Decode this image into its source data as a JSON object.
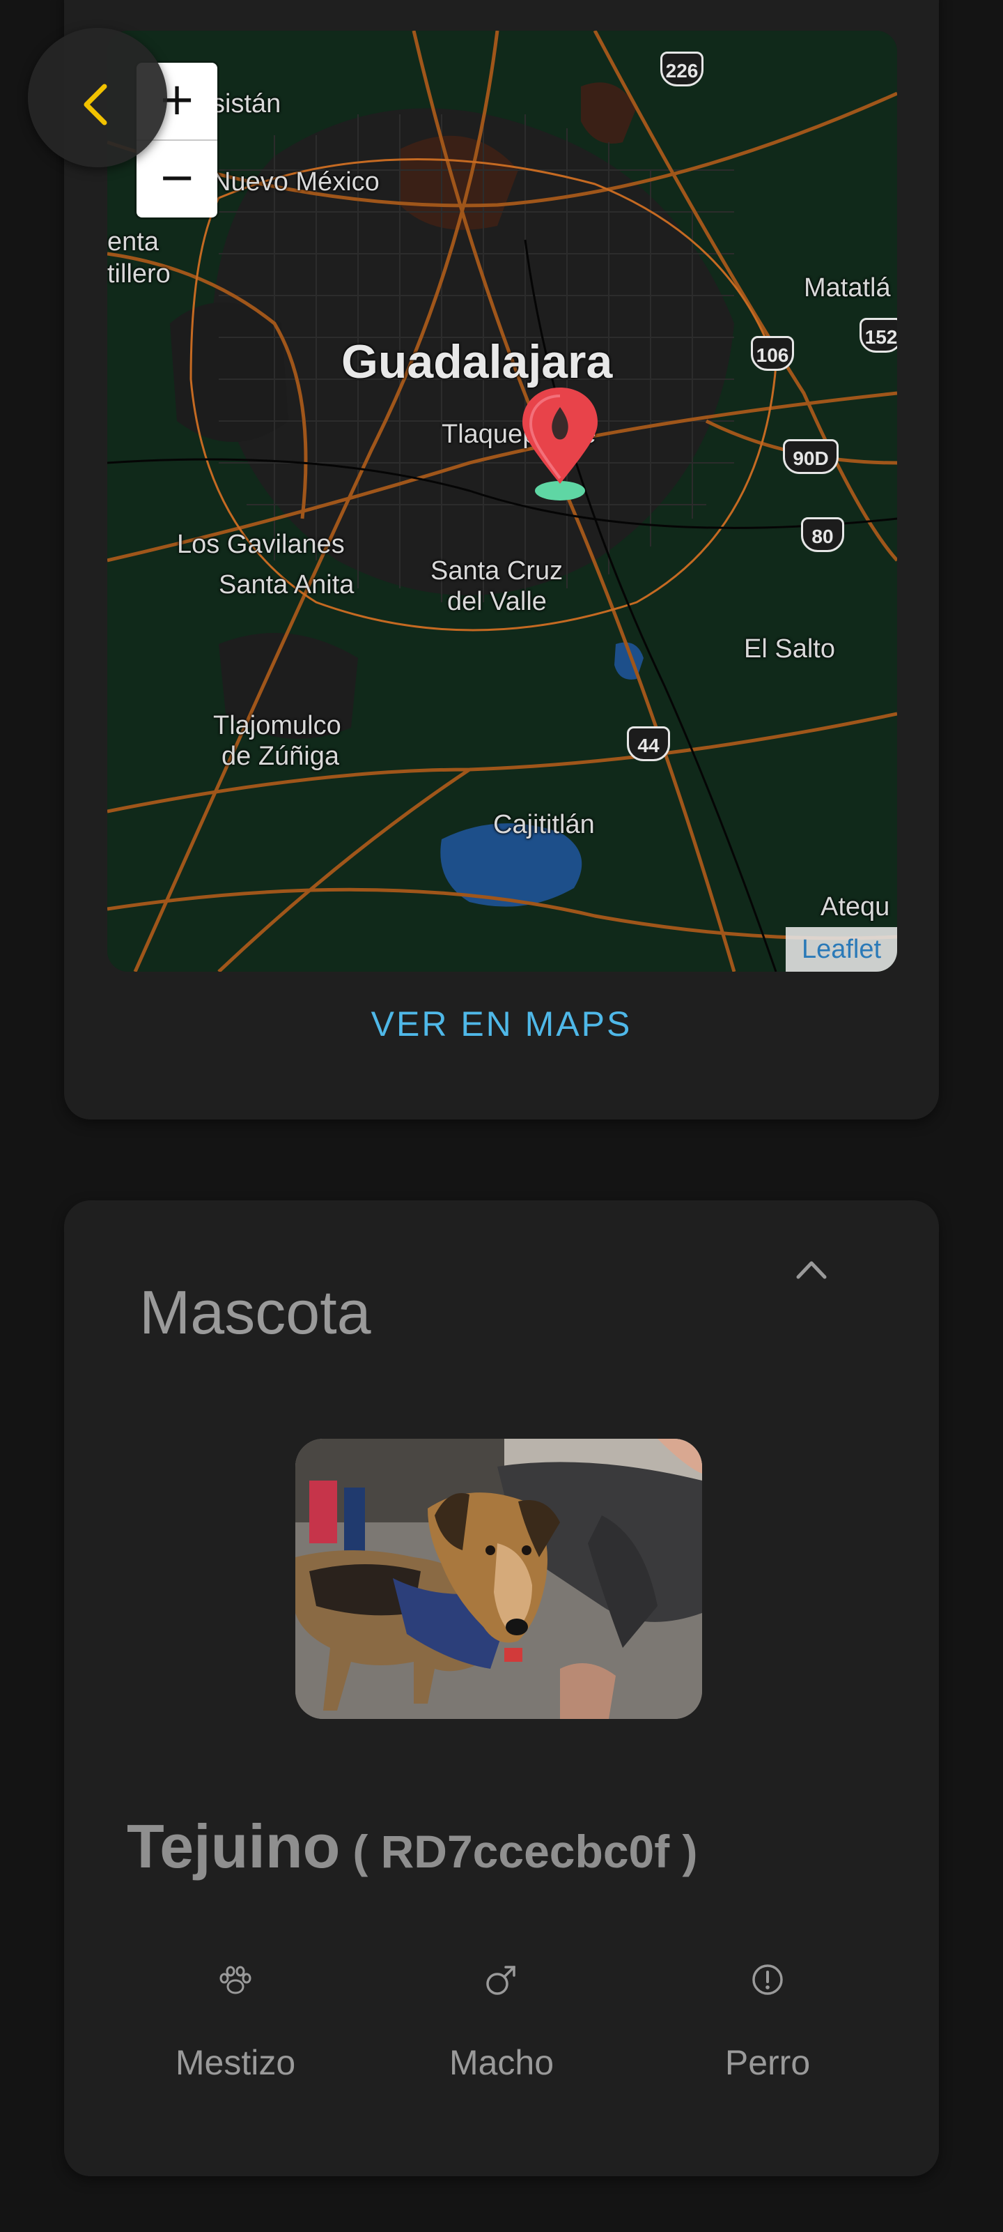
{
  "map": {
    "zoom_in_label": "+",
    "zoom_out_label": "−",
    "attribution": "Leaflet",
    "places": {
      "guadalajara": "Guadalajara",
      "tlaquepaque": "Tlaquepaque",
      "nuevo_mexico": "Nuevo México",
      "sistan": "sistán",
      "enta": "enta",
      "tillero": "tillero",
      "matatlan": "Matatlá",
      "los_gavilanes": "Los Gavilanes",
      "santa_anita": "Santa Anita",
      "santa_cruz": "Santa Cruz",
      "del_valle": "del Valle",
      "el_salto": "El Salto",
      "tlajomulco": "Tlajomulco",
      "de_zuniga": "de Zúñiga",
      "cajititlan": "Cajititlán",
      "atequ": "Atequ"
    },
    "highways": [
      "226",
      "106",
      "152",
      "90D",
      "80",
      "44"
    ]
  },
  "location": {
    "view_maps_label": "VER EN MAPS"
  },
  "pet": {
    "section_title": "Mascota",
    "name": "Tejuino",
    "id": "( RD7ccecbc0f )",
    "breed": "Mestizo",
    "sex": "Macho",
    "species": "Perro"
  },
  "colors": {
    "accent_link": "#4fb8e8",
    "back_arrow": "#f2c200",
    "background": "#141414",
    "card": "#1f1f1f"
  },
  "icons": {
    "back": "chevron-left-icon",
    "collapse": "chevron-up-icon",
    "breed": "paw-icon",
    "sex": "male-icon",
    "species": "info-alert-icon",
    "location": "map-pin-icon"
  }
}
